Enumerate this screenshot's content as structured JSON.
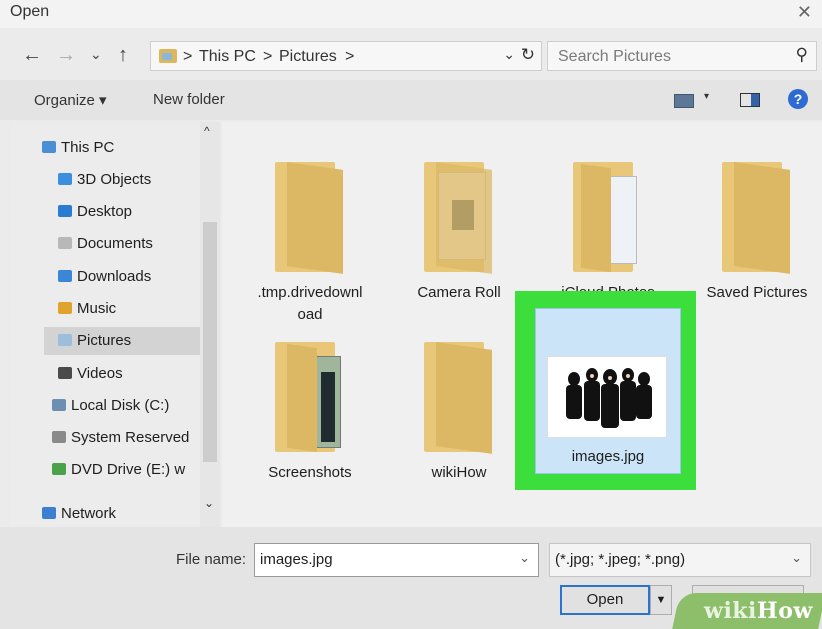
{
  "window": {
    "title": "Open",
    "close_glyph": "✕"
  },
  "nav_buttons": {
    "back": "←",
    "forward": "→",
    "recent": "⌄",
    "up": "↑"
  },
  "address": {
    "sep1": ">",
    "crumb1": "This PC",
    "sep2": ">",
    "crumb2": "Pictures",
    "sep3": ">",
    "dropdown": "⌄",
    "refresh": "↻"
  },
  "search": {
    "placeholder": "Search Pictures",
    "icon": "⚲"
  },
  "toolbar": {
    "organize": "Organize ▾",
    "new_folder": "New folder",
    "help": "?"
  },
  "sidebar": {
    "items": [
      {
        "label": "This PC",
        "icon": "computer-icon",
        "color": "#4a8fd6"
      },
      {
        "label": "3D Objects",
        "icon": "cube-icon",
        "color": "#3a8fe0"
      },
      {
        "label": "Desktop",
        "icon": "desktop-icon",
        "color": "#2a7cd1"
      },
      {
        "label": "Documents",
        "icon": "document-icon",
        "color": "#b8b8b8"
      },
      {
        "label": "Downloads",
        "icon": "download-icon",
        "color": "#3a87d8"
      },
      {
        "label": "Music",
        "icon": "music-icon",
        "color": "#e0a42e"
      },
      {
        "label": "Pictures",
        "icon": "pictures-icon",
        "color": "#9cbedc"
      },
      {
        "label": "Videos",
        "icon": "videos-icon",
        "color": "#4a4a4a"
      },
      {
        "label": "Local Disk (C:)",
        "icon": "disk-icon",
        "color": "#6c8fb2"
      },
      {
        "label": "System Reserved",
        "icon": "disk-icon",
        "color": "#8a8a8a"
      },
      {
        "label": "DVD Drive (E:) w",
        "icon": "dvd-icon",
        "color": "#4aa24a"
      },
      {
        "label": "Network",
        "icon": "network-icon",
        "color": "#3a7fd0"
      }
    ],
    "scroll_up": "^",
    "scroll_down": "⌄"
  },
  "files": [
    {
      "label": ".tmp.drivedownl oad",
      "type": "folder"
    },
    {
      "label": "Camera Roll",
      "type": "folder"
    },
    {
      "label": "iCloud Photos",
      "type": "folder"
    },
    {
      "label": "Saved Pictures",
      "type": "folder"
    },
    {
      "label": "Screenshots",
      "type": "folder"
    },
    {
      "label": "wikiHow",
      "type": "folder"
    },
    {
      "label": "images.jpg",
      "type": "image",
      "selected": true
    }
  ],
  "footer": {
    "file_name_label": "File name:",
    "file_name_value": "images.jpg",
    "file_type_value": "(*.jpg; *.jpeg; *.png)",
    "open_label": "Open",
    "cancel_label": "Cancel",
    "dropdown": "⌄",
    "open_split": "▼"
  },
  "watermark": {
    "text_prefix": "wiki",
    "text_suffix": "How"
  },
  "colors": {
    "selection_highlight": "#3bde3b",
    "accent": "#2c73cf"
  }
}
